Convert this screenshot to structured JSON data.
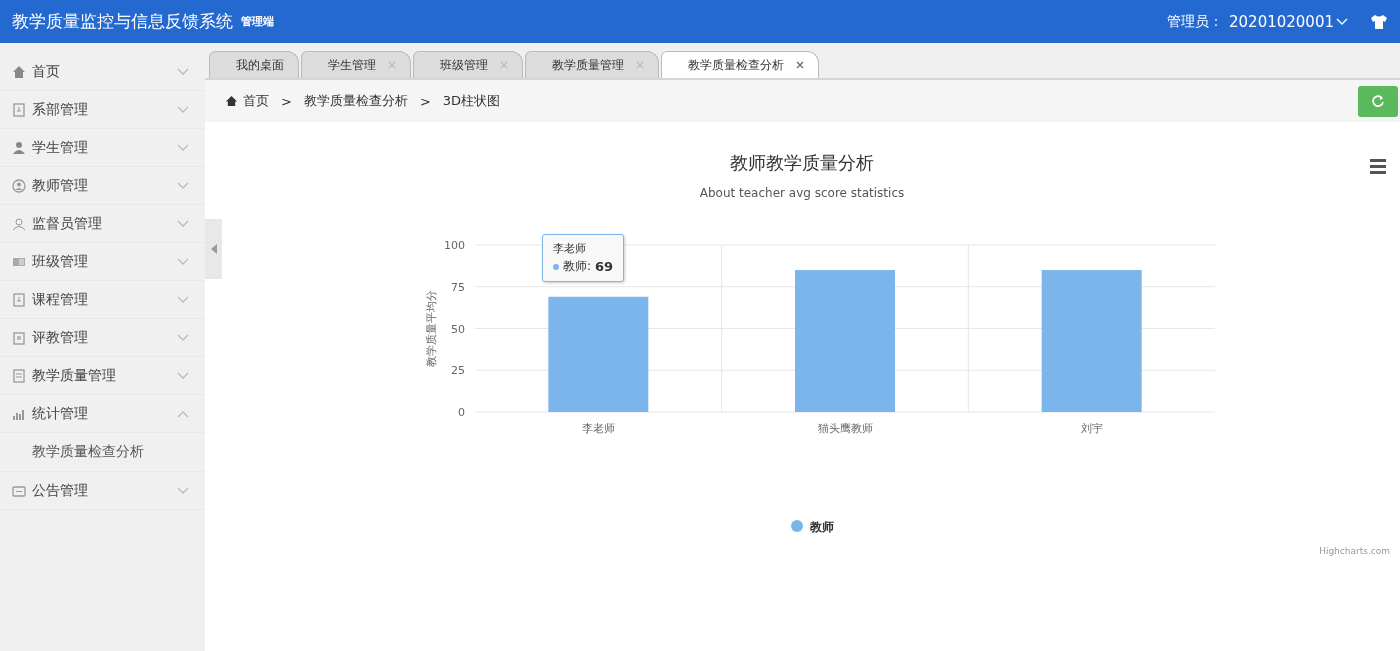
{
  "header": {
    "title": "教学质量监控与信息反馈系统",
    "badge": "管理端",
    "user_label": "管理员：",
    "user_id": "20201020001"
  },
  "sidebar": {
    "items": [
      {
        "label": "首页",
        "expanded": false
      },
      {
        "label": "系部管理",
        "expanded": false
      },
      {
        "label": "学生管理",
        "expanded": false
      },
      {
        "label": "教师管理",
        "expanded": false
      },
      {
        "label": "监督员管理",
        "expanded": false
      },
      {
        "label": "班级管理",
        "expanded": false
      },
      {
        "label": "课程管理",
        "expanded": false
      },
      {
        "label": "评教管理",
        "expanded": false
      },
      {
        "label": "教学质量管理",
        "expanded": false
      },
      {
        "label": "统计管理",
        "expanded": true,
        "children": [
          {
            "label": "教学质量检查分析"
          }
        ]
      },
      {
        "label": "公告管理",
        "expanded": false
      }
    ]
  },
  "tabs": [
    {
      "label": "我的桌面",
      "closable": false,
      "selected": false
    },
    {
      "label": "学生管理",
      "closable": true,
      "selected": false
    },
    {
      "label": "班级管理",
      "closable": true,
      "selected": false
    },
    {
      "label": "教学质量管理",
      "closable": true,
      "selected": false
    },
    {
      "label": "教学质量检查分析",
      "closable": true,
      "selected": true
    }
  ],
  "breadcrumb": {
    "separator": ">",
    "items": [
      "首页",
      "教学质量检查分析",
      "3D柱状图"
    ]
  },
  "chart": {
    "subtitle": "About teacher avg score statistics",
    "tooltip": {
      "title": "李老师",
      "series": "教师:",
      "value": "69"
    },
    "credit": "Highcharts.com",
    "chart_data": {
      "type": "bar",
      "title": "教师教学质量分析",
      "ylabel": "教学质量平均分",
      "categories": [
        "李老师",
        "猫头鹰教师",
        "刘宇"
      ],
      "series": [
        {
          "name": "教师",
          "color": "#7cb5ec",
          "values": [
            69,
            85,
            85
          ]
        }
      ],
      "ylim": [
        0,
        100
      ],
      "yticks": [
        0,
        25,
        50,
        75,
        100
      ],
      "grid": true
    }
  }
}
